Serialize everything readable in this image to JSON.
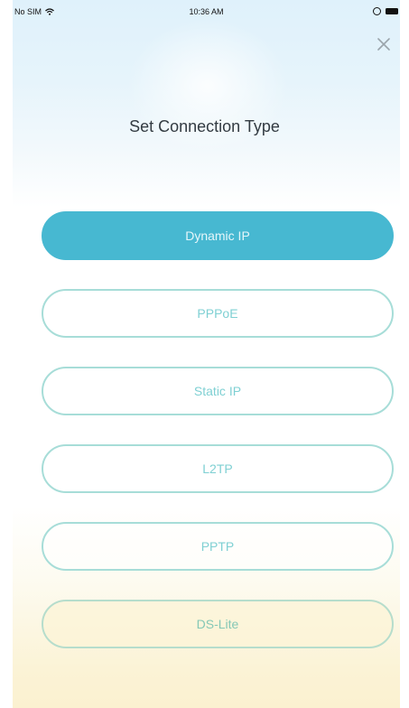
{
  "status_bar": {
    "carrier": "No SIM",
    "time": "10:36 AM"
  },
  "header": {
    "title": "Set Connection Type",
    "close_icon": "close-icon"
  },
  "options": [
    {
      "label": "Dynamic IP",
      "selected": true
    },
    {
      "label": "PPPoE",
      "selected": false
    },
    {
      "label": "Static IP",
      "selected": false
    },
    {
      "label": "L2TP",
      "selected": false
    },
    {
      "label": "PPTP",
      "selected": false
    },
    {
      "label": "DS-Lite",
      "selected": false
    }
  ],
  "colors": {
    "accent": "#47b8d1",
    "outline": "#a7ddd8",
    "title": "#333b42"
  }
}
